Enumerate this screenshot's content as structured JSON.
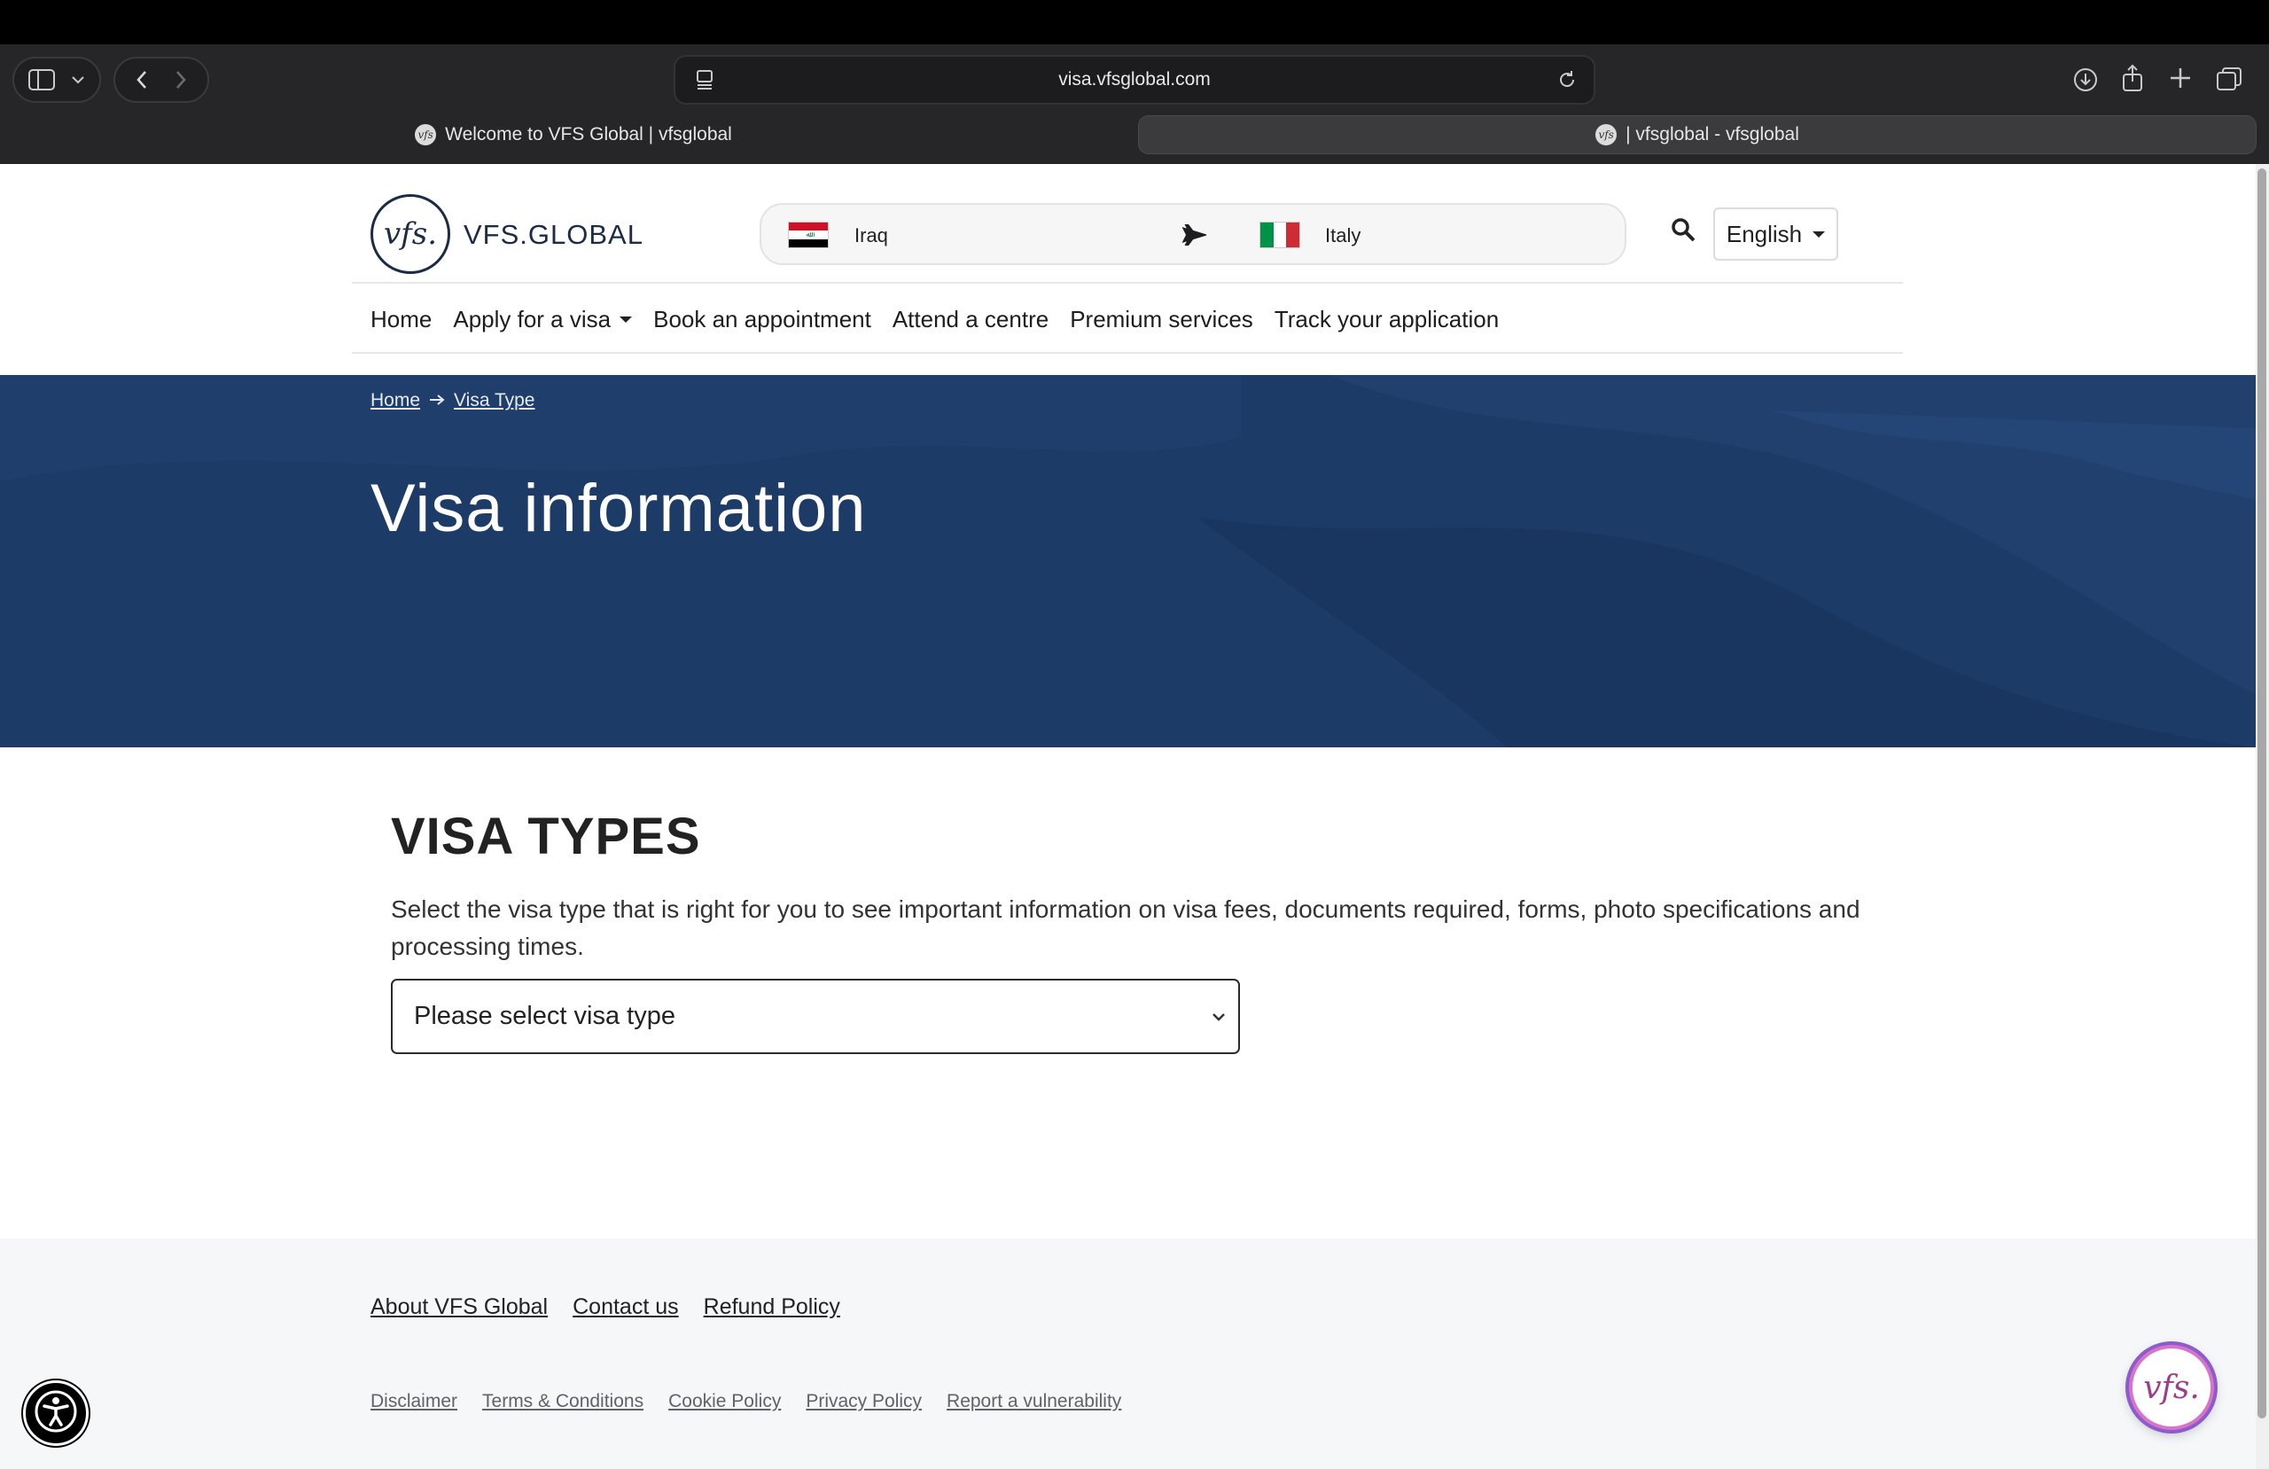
{
  "browser": {
    "url": "visa.vfsglobal.com",
    "tabs": [
      {
        "label": "Welcome to VFS Global | vfsglobal",
        "active": false
      },
      {
        "label": "| vfsglobal - vfsglobal",
        "active": true
      }
    ],
    "icons": [
      "sidebar-icon",
      "chevron-down-icon",
      "back-icon",
      "forward-icon",
      "reader-icon",
      "reload-icon",
      "download-icon",
      "share-icon",
      "new-tab-icon",
      "tab-overview-icon"
    ]
  },
  "header": {
    "logo_text": "VFS.GLOBAL",
    "logo_mark": "vfs.",
    "from_country": "Iraq",
    "to_country": "Italy",
    "language": "English"
  },
  "nav": {
    "items": [
      "Home",
      "Apply for a visa",
      "Book an appointment",
      "Attend a centre",
      "Premium services",
      "Track your application"
    ]
  },
  "hero": {
    "breadcrumb": [
      "Home",
      "Visa Type"
    ],
    "title": "Visa information"
  },
  "main": {
    "heading": "VISA TYPES",
    "description": "Select the visa type that is right for you to see important information on visa fees, documents required, forms, photo specifications and processing times.",
    "select_placeholder": "Please select visa type"
  },
  "footer": {
    "links": [
      "About VFS Global",
      "Contact us",
      "Refund Policy"
    ],
    "small_links": [
      "Disclaimer",
      "Terms & Conditions",
      "Cookie Policy",
      "Privacy Policy",
      "Report a vulnerability"
    ]
  },
  "floating": {
    "chat_label": "vfs."
  },
  "colors": {
    "hero_bg": "#1d3b67",
    "brand_navy": "#1b2b48",
    "footer_bg": "#f6f7f9",
    "chrome_bg": "#262628"
  }
}
